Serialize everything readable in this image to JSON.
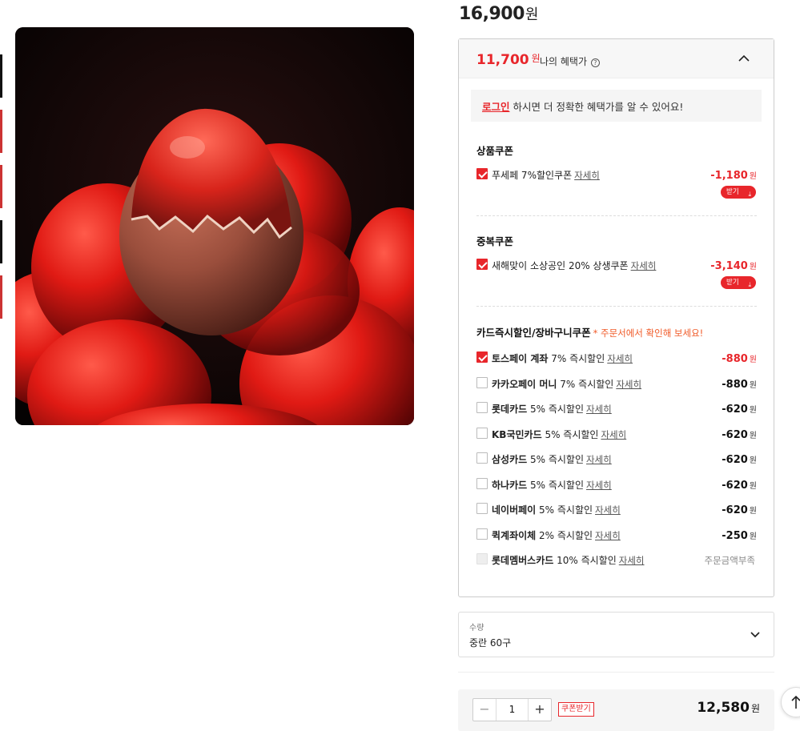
{
  "product": {
    "image_alt": "",
    "price": "16,900",
    "currency": "원"
  },
  "benefit": {
    "price": "11,700",
    "currency": "원",
    "label": "나의 혜택가",
    "help_icon": "?",
    "login_link": "로그인",
    "login_notice": "하시면 더 정확한 혜택가를 알 수 있어요!"
  },
  "sections": {
    "product_coupon": {
      "title": "상품쿠폰",
      "items": [
        {
          "label": "푸세페 7%할인쿠폰",
          "detail": "자세히",
          "amount": "-1,180",
          "currency": "원",
          "checked": true,
          "button": "받기"
        }
      ]
    },
    "dup_coupon": {
      "title": "중복쿠폰",
      "items": [
        {
          "label": "새해맞이 소상공인 20% 상생쿠폰",
          "detail": "자세히",
          "amount": "-3,140",
          "currency": "원",
          "checked": true,
          "button": "받기"
        }
      ]
    },
    "card": {
      "title": "카드즉시할인/장바구니쿠폰",
      "note": "* 주문서에서 확인해 보세요!",
      "items": [
        {
          "name": "토스페이 계좌",
          "desc": "7% 즉시할인",
          "detail": "자세히",
          "amount": "-880",
          "currency": "원",
          "state": "checked"
        },
        {
          "name": "카카오페이 머니",
          "desc": "7% 즉시할인",
          "detail": "자세히",
          "amount": "-880",
          "currency": "원",
          "state": "unchecked"
        },
        {
          "name": "롯데카드",
          "desc": "5% 즉시할인",
          "detail": "자세히",
          "amount": "-620",
          "currency": "원",
          "state": "unchecked"
        },
        {
          "name": "KB국민카드",
          "desc": "5% 즉시할인",
          "detail": "자세히",
          "amount": "-620",
          "currency": "원",
          "state": "unchecked"
        },
        {
          "name": "삼성카드",
          "desc": "5% 즉시할인",
          "detail": "자세히",
          "amount": "-620",
          "currency": "원",
          "state": "unchecked"
        },
        {
          "name": "하나카드",
          "desc": "5% 즉시할인",
          "detail": "자세히",
          "amount": "-620",
          "currency": "원",
          "state": "unchecked"
        },
        {
          "name": "네이버페이",
          "desc": "5% 즉시할인",
          "detail": "자세히",
          "amount": "-620",
          "currency": "원",
          "state": "unchecked"
        },
        {
          "name": "퀵계좌이체",
          "desc": "2% 즉시할인",
          "detail": "자세히",
          "amount": "-250",
          "currency": "원",
          "state": "unchecked"
        },
        {
          "name": "롯데멤버스카드",
          "desc": "10% 즉시할인",
          "detail": "자세히",
          "amount": "주문금액부족",
          "currency": "",
          "state": "disabled"
        }
      ]
    }
  },
  "quantity_select": {
    "label": "수량",
    "value": "중란 60구"
  },
  "order": {
    "minus": "−",
    "plus": "+",
    "quantity": "1",
    "coupon_button": "쿠폰받기",
    "total": "12,580",
    "currency": "원"
  },
  "colors": {
    "accent": "#e8262b",
    "note": "#f05a28"
  },
  "icons": {
    "collapse": "chevron-up-icon",
    "dropdown": "chevron-down-icon",
    "download": "download-icon",
    "scroll_top": "arrow-up-icon"
  }
}
